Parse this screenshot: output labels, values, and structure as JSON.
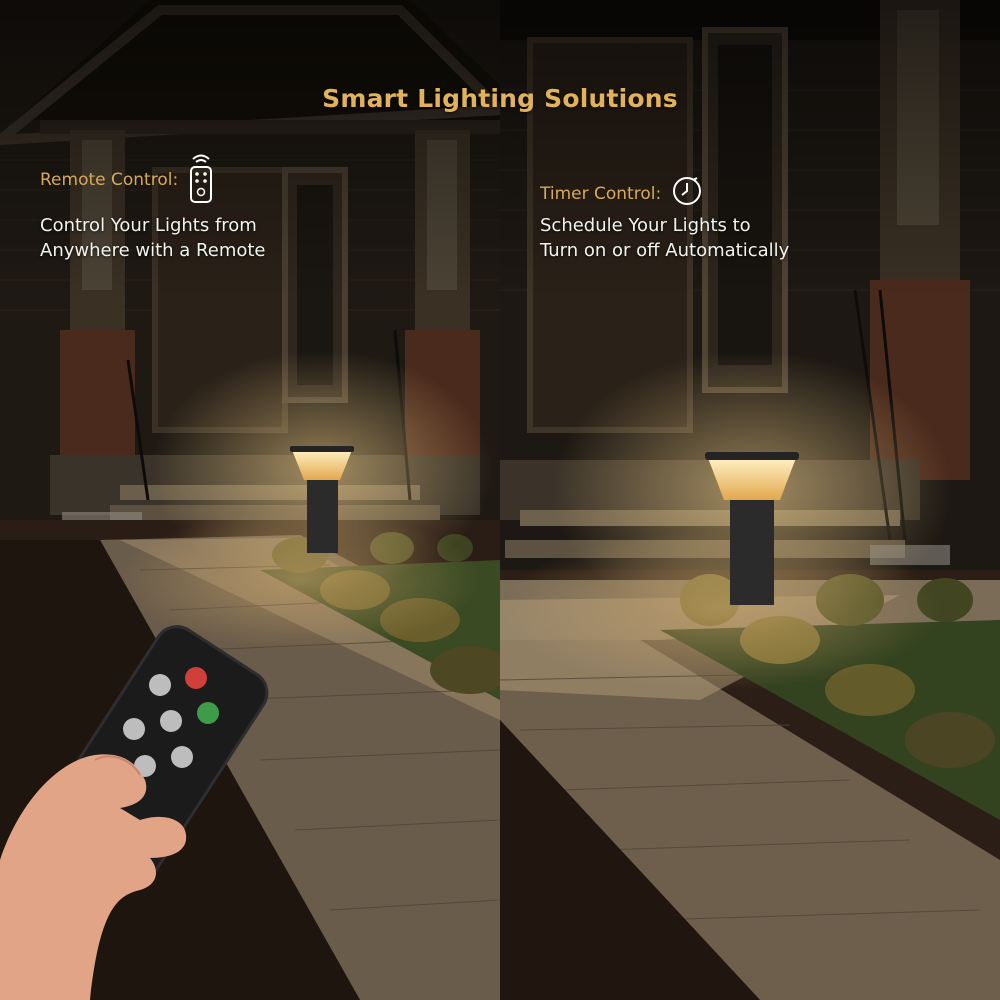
{
  "header": {
    "title": "Smart Lighting Solutions"
  },
  "left_feature": {
    "heading": "Remote Control:",
    "icon": "remote-control-icon",
    "line1": "Control Your Lights from",
    "line2": "Anywhere with a Remote"
  },
  "right_feature": {
    "heading": "Timer Control:",
    "icon": "clock-icon",
    "line1": "Schedule Your Lights to",
    "line2": "Turn on or off Automatically"
  },
  "colors": {
    "accent": "#e2b25a",
    "body_text": "#f2f2ee",
    "lamp_glow": "#f7d58e"
  }
}
